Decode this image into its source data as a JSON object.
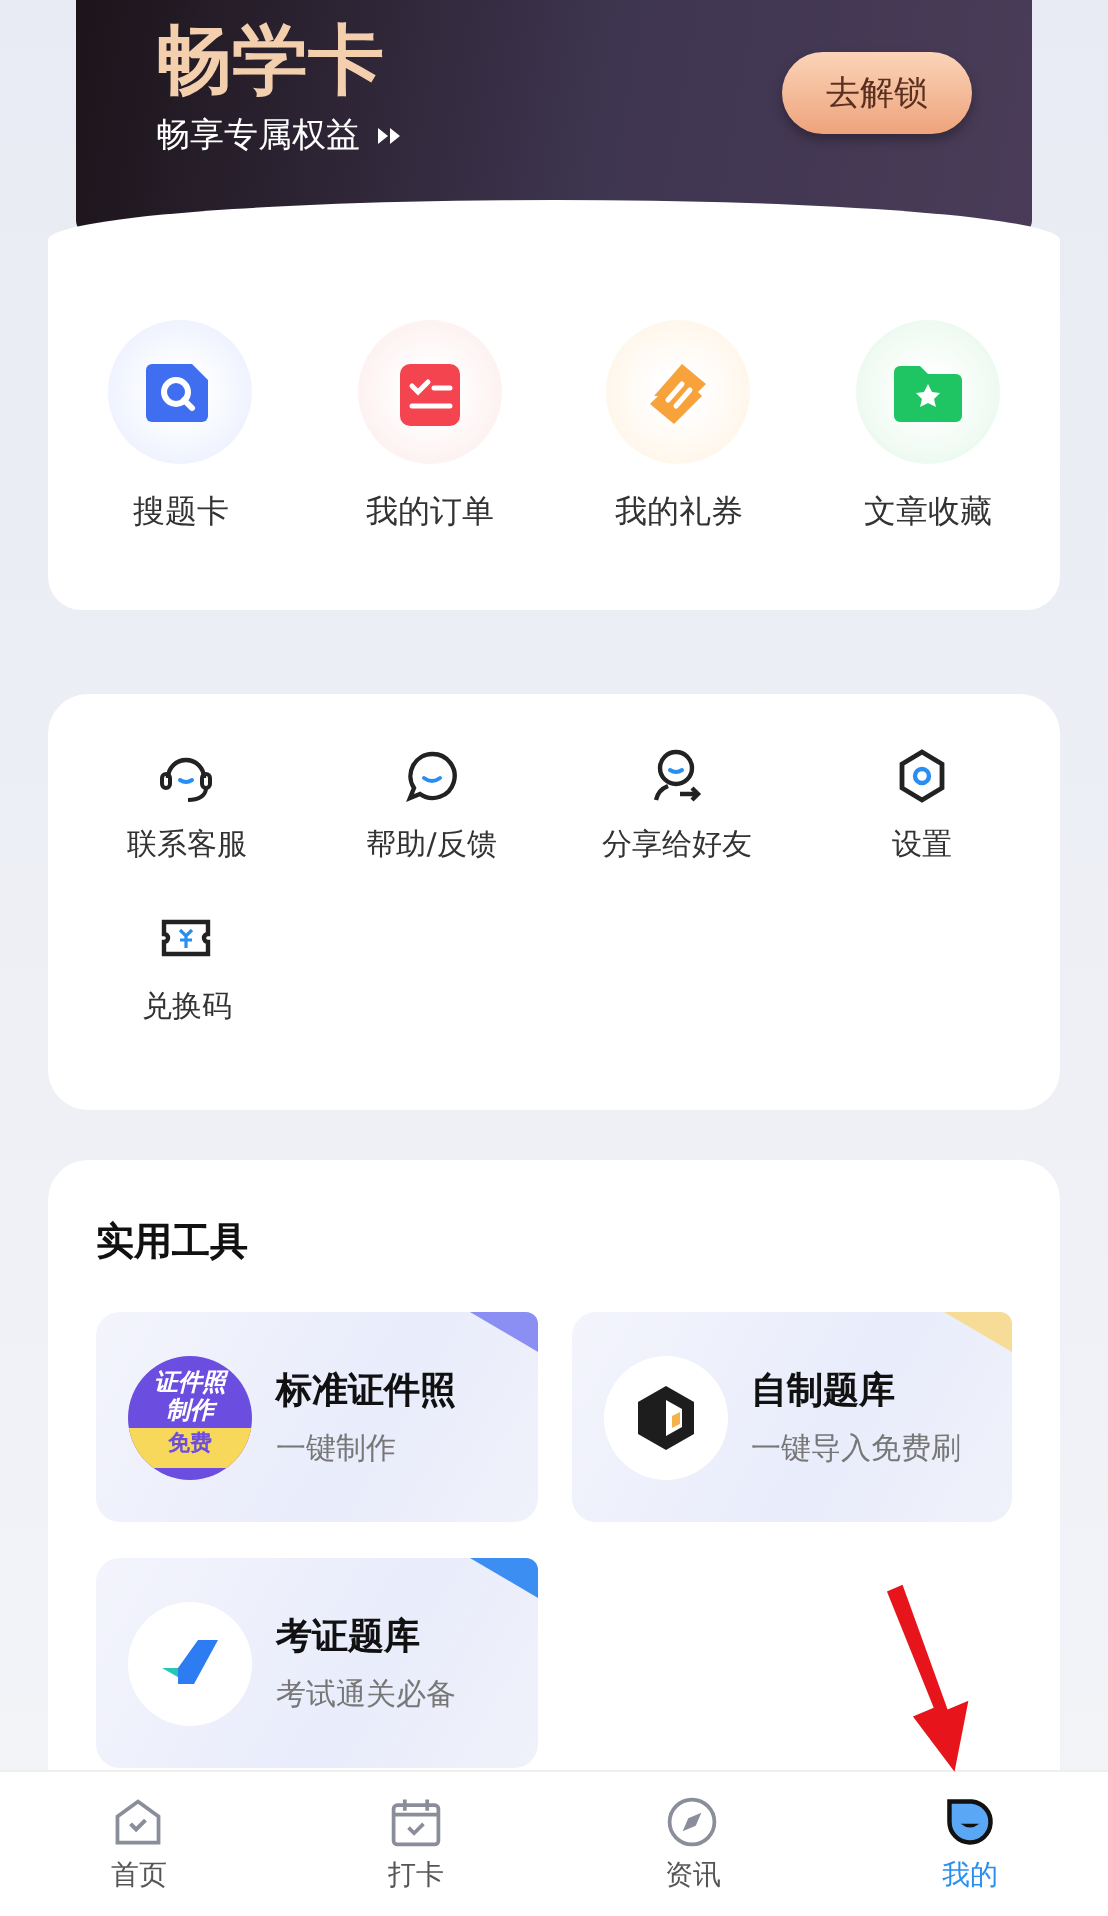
{
  "vip_card": {
    "title": "畅学卡",
    "subtitle": "畅享专属权益",
    "button": "去解锁"
  },
  "quick_links": [
    {
      "kind": "search",
      "label": "搜题卡"
    },
    {
      "kind": "orders",
      "label": "我的订单"
    },
    {
      "kind": "coupons",
      "label": "我的礼券"
    },
    {
      "kind": "favorites",
      "label": "文章收藏"
    }
  ],
  "services": [
    {
      "kind": "support",
      "label": "联系客服"
    },
    {
      "kind": "feedback",
      "label": "帮助/反馈"
    },
    {
      "kind": "share",
      "label": "分享给好友"
    },
    {
      "kind": "settings",
      "label": "设置"
    },
    {
      "kind": "redeem",
      "label": "兑换码"
    }
  ],
  "tools": {
    "title": "实用工具",
    "items": [
      {
        "kind": "id-photo",
        "title": "标准证件照",
        "subtitle": "一键制作",
        "color": "#8b8ef2",
        "badge_lines": [
          "证件照",
          "制作"
        ],
        "badge_tag": "免费"
      },
      {
        "kind": "cube",
        "title": "自制题库",
        "subtitle": "一键导入免费刷",
        "color": "#f6dc96"
      },
      {
        "kind": "check",
        "title": "考证题库",
        "subtitle": "考试通关必备",
        "color": "#3d8ef2"
      }
    ]
  },
  "tab_bar": [
    {
      "kind": "home",
      "label": "首页",
      "selected": false
    },
    {
      "kind": "checkin",
      "label": "打卡",
      "selected": false
    },
    {
      "kind": "news",
      "label": "资讯",
      "selected": false
    },
    {
      "kind": "me",
      "label": "我的",
      "selected": true
    }
  ]
}
